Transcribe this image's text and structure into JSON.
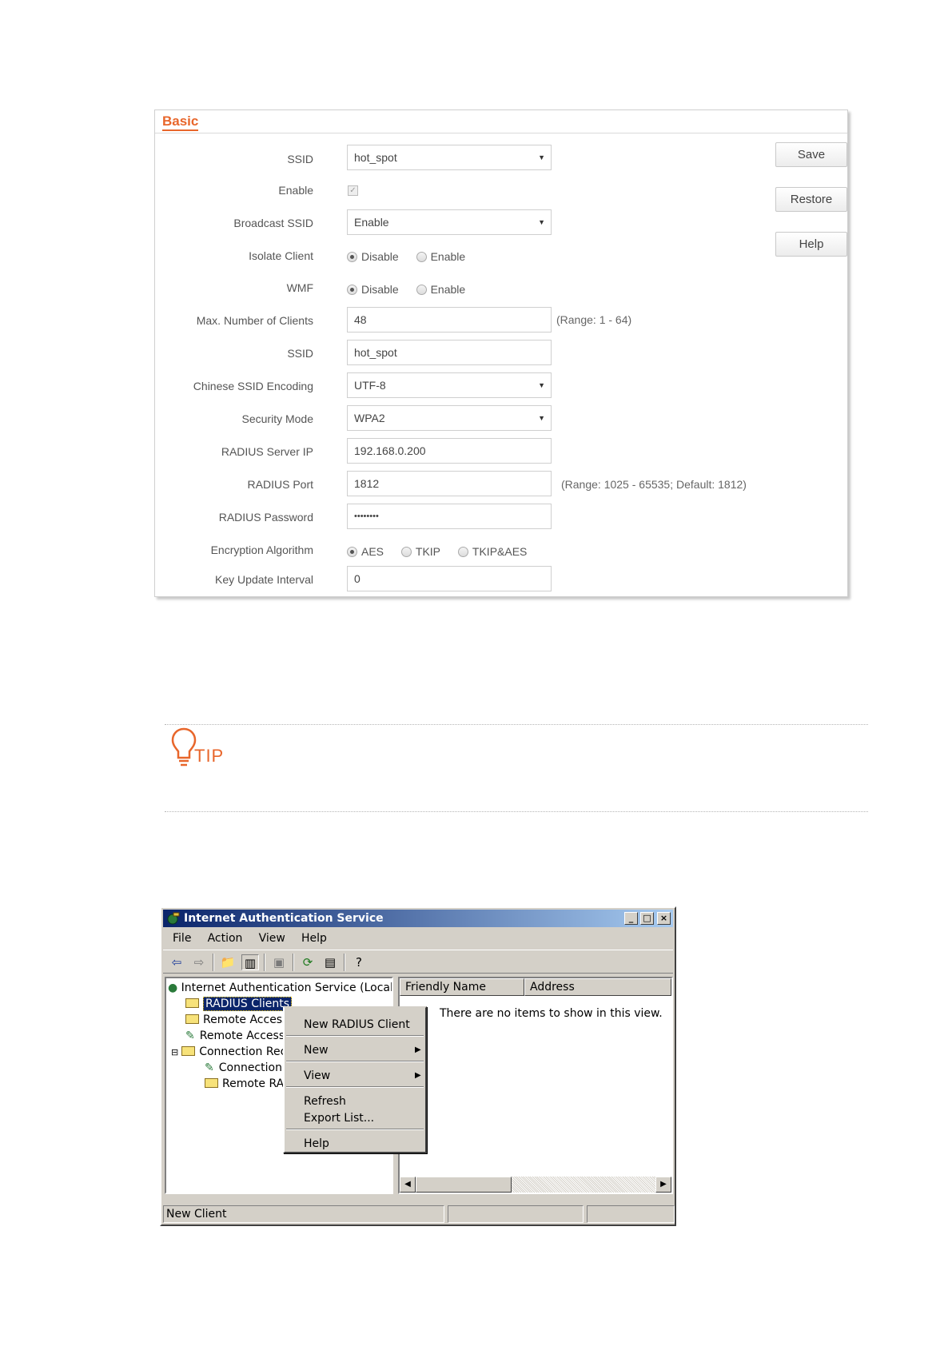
{
  "router_panel": {
    "title": "Basic",
    "fields": {
      "ssid_select": {
        "label": "SSID",
        "value": "hot_spot"
      },
      "enable": {
        "label": "Enable",
        "checked": true
      },
      "broadcast_ssid": {
        "label": "Broadcast SSID",
        "value": "Enable"
      },
      "isolate_client": {
        "label": "Isolate Client",
        "options": [
          "Disable",
          "Enable"
        ],
        "selected": "Disable"
      },
      "wmf": {
        "label": "WMF",
        "options": [
          "Disable",
          "Enable"
        ],
        "selected": "Disable"
      },
      "max_clients": {
        "label": "Max. Number of Clients",
        "value": "48",
        "hint": "(Range: 1 - 64)"
      },
      "ssid_input": {
        "label": "SSID",
        "value": "hot_spot"
      },
      "chinese_ssid_encoding": {
        "label": "Chinese SSID Encoding",
        "value": "UTF-8"
      },
      "security_mode": {
        "label": "Security Mode",
        "value": "WPA2"
      },
      "radius_server_ip": {
        "label": "RADIUS Server IP",
        "value": "192.168.0.200"
      },
      "radius_port": {
        "label": "RADIUS Port",
        "value": "1812",
        "hint": "(Range: 1025 - 65535; Default: 1812)"
      },
      "radius_password": {
        "label": "RADIUS Password",
        "value": "••••••••"
      },
      "encryption_algorithm": {
        "label": "Encryption Algorithm",
        "options": [
          "AES",
          "TKIP",
          "TKIP&AES"
        ],
        "selected": "AES"
      },
      "key_update_interval": {
        "label": "Key Update Interval",
        "value": "0"
      }
    },
    "buttons": {
      "save": "Save",
      "restore": "Restore",
      "help": "Help"
    }
  },
  "tip": {
    "label": "TIP",
    "icon": "lightbulb-icon"
  },
  "ias_window": {
    "title": "Internet Authentication Service",
    "menu": {
      "file": "File",
      "action": "Action",
      "view": "View",
      "help": "Help"
    },
    "tree": {
      "root": "Internet Authentication Service (Local)",
      "radius_clients": "RADIUS Clients",
      "remote_access_1": "Remote Access",
      "remote_access_2": "Remote Access",
      "connection_req": "Connection Rec",
      "connection": "Connection",
      "remote_ra": "Remote RA"
    },
    "list": {
      "columns": [
        "Friendly Name",
        "Address"
      ],
      "empty_message": "There are no items to show in this view."
    },
    "status": "New Client",
    "context_menu": {
      "new_radius_client": "New RADIUS Client",
      "new": "New",
      "view": "View",
      "refresh": "Refresh",
      "export_list": "Export List...",
      "help": "Help"
    },
    "colors": {
      "titlebar_start": "#0a246a",
      "titlebar_end": "#a6caf0",
      "chrome": "#d4d0c8"
    }
  },
  "colors": {
    "accent": "#e8662b"
  }
}
